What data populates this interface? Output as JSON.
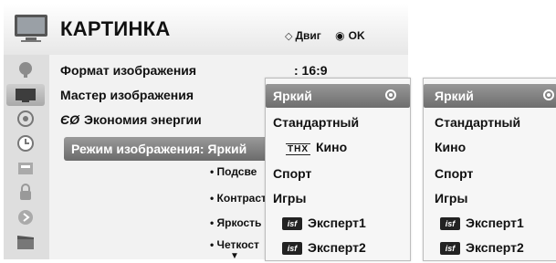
{
  "header": {
    "title": "КАРТИНКА",
    "hint_move": "Двиг",
    "hint_ok": "OK"
  },
  "sidebar": {
    "items": [
      {
        "icon": "satellite-dish-icon"
      },
      {
        "icon": "picture-tv-icon",
        "active": true
      },
      {
        "icon": "audio-icon"
      },
      {
        "icon": "time-clock-icon"
      },
      {
        "icon": "options-icon"
      },
      {
        "icon": "lock-icon"
      },
      {
        "icon": "input-icon"
      },
      {
        "icon": "movie-clapper-icon"
      }
    ]
  },
  "menu": {
    "aspect_ratio_label": "Формат изображения",
    "aspect_ratio_value": ": 16:9",
    "picture_wizard_label": "Мастер изображения",
    "energy_icon": "ЄØ",
    "energy_saving_label": "Экономия энергии",
    "picture_mode_label": "Режим изображения: Яркий",
    "sub_items": [
      "• Подсве",
      "• Контраст",
      "• Яркость",
      "• Четкост"
    ]
  },
  "dropdown_left": {
    "options": [
      {
        "label": "Яркий",
        "selected": true
      },
      {
        "label": "Стандартный"
      },
      {
        "badge": "THX",
        "label": "Кино"
      },
      {
        "label": "Спорт"
      },
      {
        "label": "Игры"
      },
      {
        "badge": "isf",
        "label": "Эксперт1"
      },
      {
        "badge": "isf",
        "label": "Эксперт2"
      }
    ]
  },
  "dropdown_right": {
    "options": [
      {
        "label": "Яркий",
        "selected": true
      },
      {
        "label": "Стандартный"
      },
      {
        "label": "Кино"
      },
      {
        "label": "Спорт"
      },
      {
        "label": "Игры"
      },
      {
        "badge": "isf",
        "label": "Эксперт1"
      },
      {
        "badge": "isf",
        "label": "Эксперт2"
      }
    ]
  },
  "colors": {
    "highlight": "#808080",
    "panel": "#f2f2f2",
    "sidebar": "#dedede"
  }
}
